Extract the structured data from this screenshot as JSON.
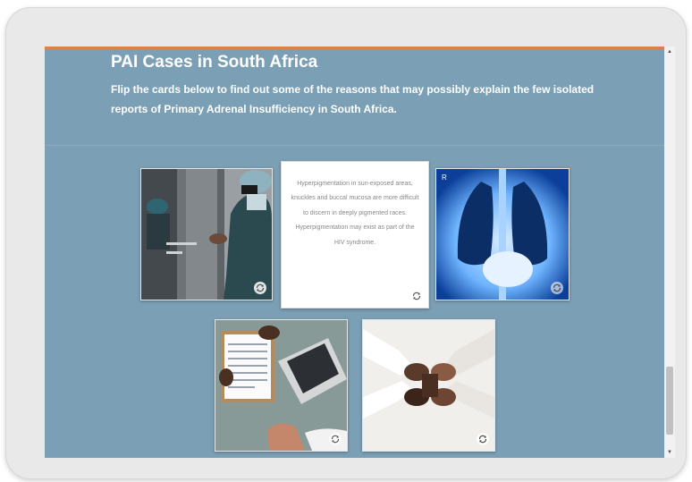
{
  "page": {
    "title": "PAI Cases in South Africa",
    "subtitle": "Flip the cards below to find out some of the reasons that may possibly explain the few isolated reports of Primary Adrenal Insufficiency in South Africa."
  },
  "cards": [
    {
      "type": "image",
      "icon": "surgeon-photo"
    },
    {
      "type": "text",
      "text": "Hyperpigmentation in sun-exposed areas, knuckles and buccal mucosa are more difficult to discern in deeply pigmented races. Hyperpigmentation may exist as part of the HIV syndrome."
    },
    {
      "type": "image",
      "icon": "chest-xray-photo"
    },
    {
      "type": "image",
      "icon": "medical-paperwork-photo"
    },
    {
      "type": "image",
      "icon": "joined-hands-photo"
    }
  ],
  "icons": {
    "flip": "flip-icon"
  },
  "colors": {
    "background": "#7b9fb5",
    "accent": "#d9834a",
    "title": "#ffffff"
  }
}
